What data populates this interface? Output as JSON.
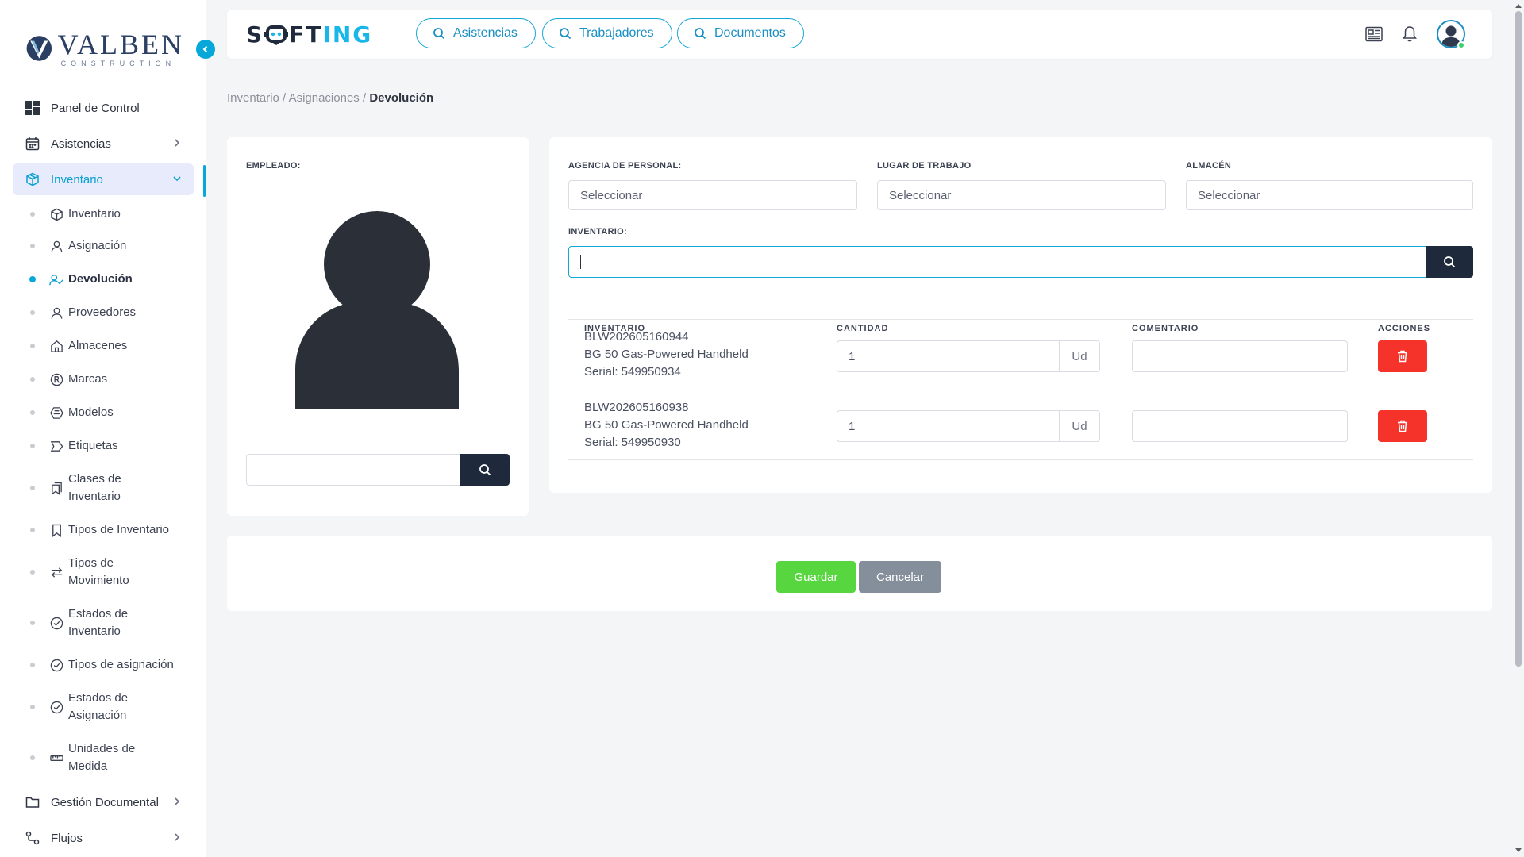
{
  "brand": {
    "logo_title": "VALBEN",
    "logo_subtitle": "CONSTRUCTION",
    "app_part1": "S",
    "app_part2": "FT",
    "app_part3": "ING"
  },
  "colors": {
    "accent": "#06a7d9",
    "dark": "#1e2a3b",
    "save": "#57d640",
    "cancel": "#858f9c",
    "delete": "#f5332a"
  },
  "sidebar": {
    "items": [
      {
        "label": "Panel de Control",
        "icon": "dashboard-icon"
      },
      {
        "label": "Asistencias",
        "icon": "calendar-icon"
      },
      {
        "label": "Inventario",
        "icon": "box-icon"
      }
    ],
    "submenu": [
      {
        "label": "Inventario",
        "icon": "box-icon"
      },
      {
        "label": "Asignación",
        "icon": "user-icon"
      },
      {
        "label": "Devolución",
        "icon": "user-check-icon"
      },
      {
        "label": "Proveedores",
        "icon": "user-icon"
      },
      {
        "label": "Almacenes",
        "icon": "home-icon"
      },
      {
        "label": "Marcas",
        "icon": "registered-icon"
      },
      {
        "label": "Modelos",
        "icon": "hexagon-icon"
      },
      {
        "label": "Etiquetas",
        "icon": "tag-icon"
      },
      {
        "label": "Clases de Inventario",
        "icon": "bookmarks-icon"
      },
      {
        "label": "Tipos de Inventario",
        "icon": "bookmark-icon"
      },
      {
        "label": "Tipos de Movimiento",
        "icon": "arrows-icon"
      },
      {
        "label": "Estados de Inventario",
        "icon": "check-circle-icon"
      },
      {
        "label": "Tipos de asignación",
        "icon": "check-circle-icon"
      },
      {
        "label": "Estados de Asignación",
        "icon": "check-circle-icon"
      },
      {
        "label": "Unidades de Medida",
        "icon": "ruler-icon"
      }
    ],
    "bottom": [
      {
        "label": "Gestión Documental",
        "icon": "folder-icon"
      },
      {
        "label": "Flujos",
        "icon": "flow-icon"
      }
    ]
  },
  "header": {
    "quick_links": [
      "Asistencias",
      "Trabajadores",
      "Documentos"
    ]
  },
  "breadcrumb": {
    "part1": "Inventario",
    "sep": "/",
    "part2": "Asignaciones",
    "current": "Devolución"
  },
  "employee": {
    "label": "EMPLEADO:",
    "search_value": ""
  },
  "form": {
    "agency_label": "AGENCIA DE PERSONAL:",
    "agency_value": "Seleccionar",
    "workplace_label": "LUGAR DE TRABAJO",
    "workplace_value": "Seleccionar",
    "warehouse_label": "ALMACÉN",
    "warehouse_value": "Seleccionar",
    "inventory_label": "INVENTARIO:",
    "inventory_value": ""
  },
  "table": {
    "headers": [
      "INVENTARIO",
      "CANTIDAD",
      "COMENTARIO",
      "ACCIONES"
    ],
    "rows": [
      {
        "code": "BLW202605160944",
        "name": "BG 50 Gas-Powered Handheld",
        "serial": "Serial: 549950934",
        "qty": "1",
        "unit": "Ud",
        "comment": ""
      },
      {
        "code": "BLW202605160938",
        "name": "BG 50 Gas-Powered Handheld",
        "serial": "Serial: 549950930",
        "qty": "1",
        "unit": "Ud",
        "comment": ""
      }
    ]
  },
  "actions": {
    "save": "Guardar",
    "cancel": "Cancelar"
  }
}
